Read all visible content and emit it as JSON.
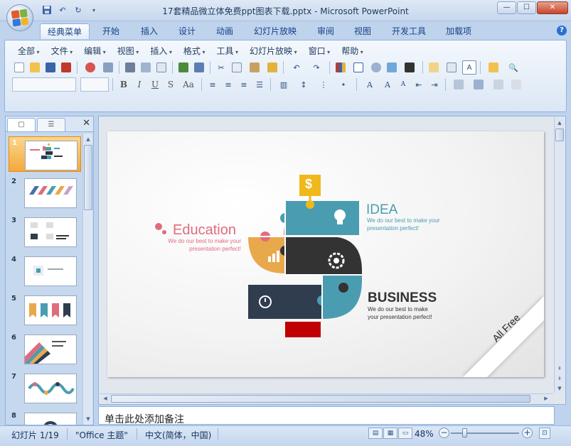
{
  "window": {
    "title": "17套精品微立体免费ppt图表下载.pptx - Microsoft PowerPoint",
    "minimize": "—",
    "maximize": "☐",
    "close": "✕"
  },
  "ribbon_tabs": [
    "经典菜单",
    "开始",
    "插入",
    "设计",
    "动画",
    "幻灯片放映",
    "审阅",
    "视图",
    "开发工具",
    "加载项"
  ],
  "classic_menu": [
    "全部",
    "文件",
    "编辑",
    "视图",
    "插入",
    "格式",
    "工具",
    "幻灯片放映",
    "窗口",
    "帮助"
  ],
  "format_buttons": [
    "B",
    "I",
    "U",
    "S",
    "Aa"
  ],
  "panel": {
    "close": "✕",
    "slide_numbers": [
      "1",
      "2",
      "3",
      "4",
      "5",
      "6",
      "7",
      "8"
    ]
  },
  "slide": {
    "education_title": "Education",
    "education_desc_1": "We do our best to make your",
    "education_desc_2": "presentation perfect!",
    "idea_title": "IDEA",
    "idea_desc_1": "We do our best to make your",
    "idea_desc_2": "presentation perfect!",
    "business_title": "BUSINESS",
    "business_desc_1": "We do our best to make",
    "business_desc_2": "your presentation perfect!",
    "ribbon_text": "All Free",
    "dollar_symbol": "$"
  },
  "notes": {
    "placeholder": "单击此处添加备注"
  },
  "status_bar": {
    "slide_counter": "幻灯片 1/19",
    "theme": "\"Office 主题\"",
    "language": "中文(简体，中国)",
    "zoom": "48%",
    "zoom_level": 0.48
  },
  "colors": {
    "education_pink": "#e06b7c",
    "idea_teal": "#4a9db0",
    "puzzle_dark": "#333333",
    "puzzle_navy": "#2f3d4f",
    "puzzle_orange": "#e8a84c",
    "dollar_yellow": "#f0b81b",
    "accent_red": "#c00000"
  }
}
